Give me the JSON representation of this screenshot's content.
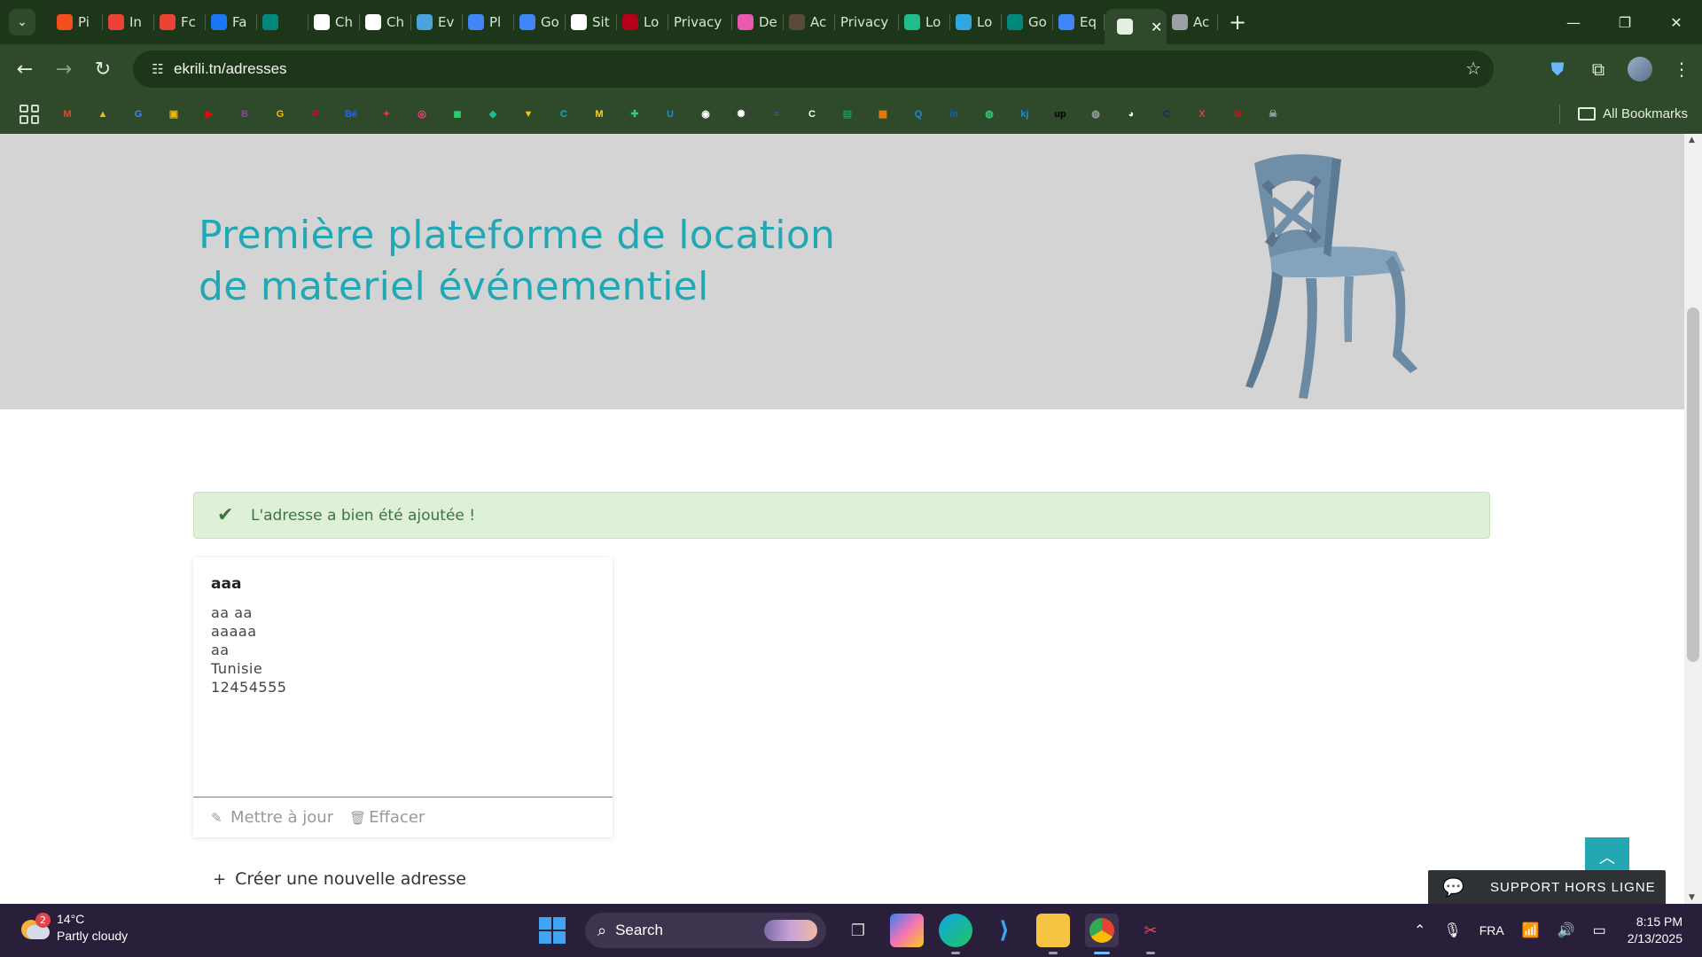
{
  "browser": {
    "tabs": [
      {
        "label": "Pi",
        "icon": "figma-icon",
        "color": "#f24e1e"
      },
      {
        "label": "In",
        "icon": "gmail-icon",
        "color": "#ea4335"
      },
      {
        "label": "Fc",
        "icon": "gmail-icon",
        "color": "#ea4335"
      },
      {
        "label": "Fa",
        "icon": "facebook-icon",
        "color": "#1877f2"
      },
      {
        "label": "",
        "icon": "meet-icon",
        "color": "#00897b"
      },
      {
        "label": "Ch",
        "icon": "chatgpt-icon",
        "color": "#ffffff"
      },
      {
        "label": "Ch",
        "icon": "chatgpt-icon",
        "color": "#ffffff"
      },
      {
        "label": "Ev",
        "icon": "doc-icon",
        "color": "#4aa3df"
      },
      {
        "label": "Pl",
        "icon": "google-docs-icon",
        "color": "#4285f4"
      },
      {
        "label": "Go",
        "icon": "google-translate-icon",
        "color": "#4285f4"
      },
      {
        "label": "Sit",
        "icon": "chatgpt-icon",
        "color": "#ffffff"
      },
      {
        "label": "Lo",
        "icon": "circle-icon",
        "color": "#b3001b"
      },
      {
        "label": "Privacy",
        "icon": "none",
        "color": ""
      },
      {
        "label": "De",
        "icon": "flower-icon",
        "color": "#e85aad"
      },
      {
        "label": "Ac",
        "icon": "bar-icon",
        "color": "#5b4a3a"
      },
      {
        "label": "Privacy",
        "icon": "none",
        "color": ""
      },
      {
        "label": "Lo",
        "icon": "b-logo-icon",
        "color": "#1fbd8a"
      },
      {
        "label": "Lo",
        "icon": "loader-icon",
        "color": "#2fa7e0"
      },
      {
        "label": "Go",
        "icon": "meet-icon",
        "color": "#00897b"
      },
      {
        "label": "Eq",
        "icon": "google-icon",
        "color": "#4285f4"
      },
      {
        "label": "",
        "icon": "page-icon",
        "color": "#e6efe3",
        "active": true
      },
      {
        "label": "Ac",
        "icon": "triangle-icon",
        "color": "#9aa0a6"
      }
    ],
    "url": "ekrili.tn/adresses",
    "bookmarks_all_label": "All Bookmarks",
    "bookmark_icons": [
      {
        "name": "gmail-bookmark-icon",
        "glyph": "M",
        "color": "#ea4335"
      },
      {
        "name": "drive-bookmark-icon",
        "glyph": "▲",
        "color": "#fbbc04"
      },
      {
        "name": "translate-bookmark-icon",
        "glyph": "G",
        "color": "#4285f4"
      },
      {
        "name": "slides-bookmark-icon",
        "glyph": "▣",
        "color": "#f4b400"
      },
      {
        "name": "youtube-bookmark-icon",
        "glyph": "▶",
        "color": "#ff0000"
      },
      {
        "name": "bookmark-icon-6",
        "glyph": "B",
        "color": "#8e44ad"
      },
      {
        "name": "google-bookmark-icon",
        "glyph": "G",
        "color": "#fbbc04"
      },
      {
        "name": "pinterest-bookmark-icon",
        "glyph": "P",
        "color": "#e60023"
      },
      {
        "name": "behance-bookmark-icon",
        "glyph": "Bē",
        "color": "#1769ff"
      },
      {
        "name": "bookmark-icon-10",
        "glyph": "✦",
        "color": "#e53935"
      },
      {
        "name": "bookmark-icon-11",
        "glyph": "◎",
        "color": "#ff4081"
      },
      {
        "name": "bookmark-icon-12",
        "glyph": "◼",
        "color": "#2ecc71"
      },
      {
        "name": "bookmark-icon-13",
        "glyph": "◆",
        "color": "#1abc9c"
      },
      {
        "name": "bookmark-icon-14",
        "glyph": "▼",
        "color": "#f1c40f"
      },
      {
        "name": "bookmark-icon-15",
        "glyph": "C",
        "color": "#00b4d8"
      },
      {
        "name": "miro-bookmark-icon",
        "glyph": "M",
        "color": "#ffd02f"
      },
      {
        "name": "bookmark-icon-17",
        "glyph": "✚",
        "color": "#2ecc71"
      },
      {
        "name": "bookmark-icon-18",
        "glyph": "U",
        "color": "#1e88e5"
      },
      {
        "name": "bookmark-icon-19",
        "glyph": "◉",
        "color": "#ffffff"
      },
      {
        "name": "chatgpt-bookmark-icon",
        "glyph": "✺",
        "color": "#ffffff"
      },
      {
        "name": "bookmark-icon-21",
        "glyph": "≈",
        "color": "#3f51b5"
      },
      {
        "name": "bookmark-icon-22",
        "glyph": "C",
        "color": "#ffffff"
      },
      {
        "name": "bookmark-icon-23",
        "glyph": "▤",
        "color": "#0f9d58"
      },
      {
        "name": "bookmark-icon-24",
        "glyph": "▦",
        "color": "#f57c00"
      },
      {
        "name": "bookmark-icon-25",
        "glyph": "Q",
        "color": "#1e88e5"
      },
      {
        "name": "linkedin-bookmark-icon",
        "glyph": "in",
        "color": "#0a66c2"
      },
      {
        "name": "bookmark-icon-27",
        "glyph": "◍",
        "color": "#2ecc71"
      },
      {
        "name": "bookmark-icon-28",
        "glyph": "kj",
        "color": "#1e88e5"
      },
      {
        "name": "upwork-bookmark-icon",
        "glyph": "up",
        "color": "#000000"
      },
      {
        "name": "globe-bookmark-icon",
        "glyph": "◍",
        "color": "#9aa0a6"
      },
      {
        "name": "github-bookmark-icon",
        "glyph": "◕",
        "color": "#ffffff"
      },
      {
        "name": "bookmark-icon-32",
        "glyph": "C",
        "color": "#1a237e"
      },
      {
        "name": "bookmark-icon-33",
        "glyph": "X",
        "color": "#e53935"
      },
      {
        "name": "netflix-bookmark-icon",
        "glyph": "N",
        "color": "#e50914"
      },
      {
        "name": "bookmark-icon-35",
        "glyph": "☠",
        "color": "#9aa0a6"
      }
    ]
  },
  "page": {
    "hero_title_line1": "Première plateforme de location",
    "hero_title_line2": "de materiel événementiel",
    "alert_message": "L'adresse a bien été ajoutée !",
    "address_card": {
      "name": "aaa",
      "lines": [
        "aa aa",
        "aaaaa",
        "aa",
        "Tunisie",
        "12454555"
      ],
      "update_label": "Mettre à jour",
      "delete_label": "Effacer"
    },
    "create_link": "Créer une nouvelle adresse",
    "support_label": "SUPPORT HORS LIGNE"
  },
  "taskbar": {
    "weather_temp": "14°C",
    "weather_desc": "Partly cloudy",
    "weather_badge": "2",
    "search_label": "Search",
    "language": "FRA",
    "time": "8:15 PM",
    "date": "2/13/2025"
  }
}
